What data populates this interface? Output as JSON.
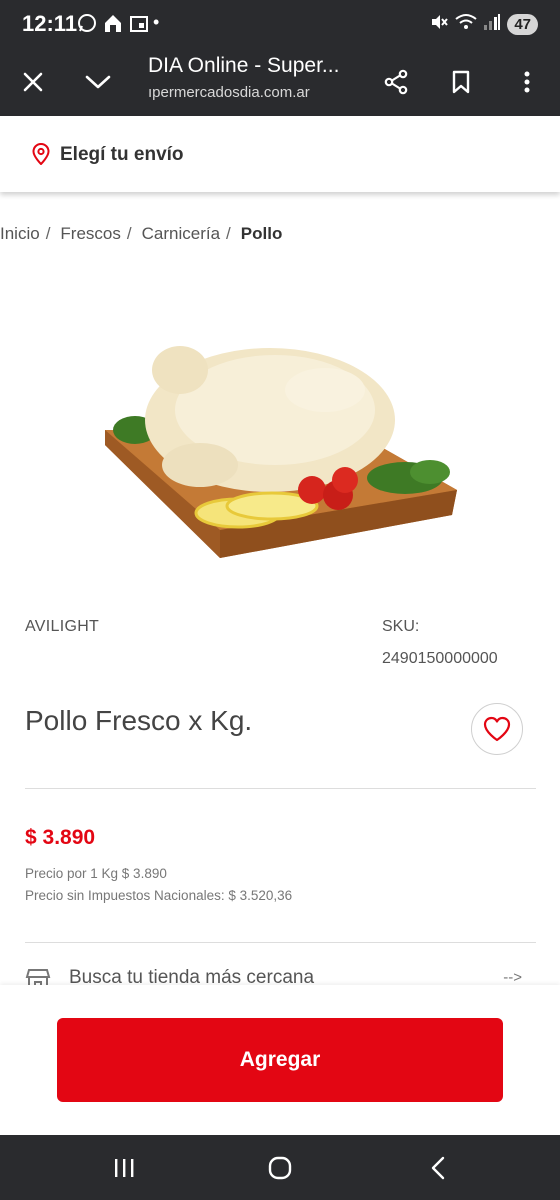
{
  "status": {
    "time": "12:11",
    "dot": "•",
    "battery": "47",
    "left_icons": [
      "whatsapp-icon",
      "home-icon",
      "calendar-icon"
    ],
    "right_icons": [
      "mute-icon",
      "wifi-icon",
      "signal-icon"
    ]
  },
  "browser": {
    "title": "DIA Online - Super...",
    "url": "ıpermercadosdia.com.ar"
  },
  "shipping": {
    "label": "Elegí tu envío"
  },
  "breadcrumb": {
    "items": [
      "Inicio",
      "Frescos",
      "Carnicería",
      "Pollo"
    ],
    "separator": "/"
  },
  "product": {
    "brand": "AVILIGHT",
    "sku_label": "SKU:",
    "sku_value": "2490150000000",
    "title": "Pollo Fresco x Kg.",
    "price": "$ 3.890",
    "price_per_kg": "Precio por 1 Kg $ 3.890",
    "price_without_taxes": "Precio sin Impuestos Nacionales: $ 3.520,36"
  },
  "store": {
    "label": "Busca tu tienda más cercana",
    "arrow": "-->"
  },
  "actions": {
    "add_label": "Agregar"
  },
  "colors": {
    "accent": "#e30613",
    "bar_dark": "#2a2b2e"
  }
}
